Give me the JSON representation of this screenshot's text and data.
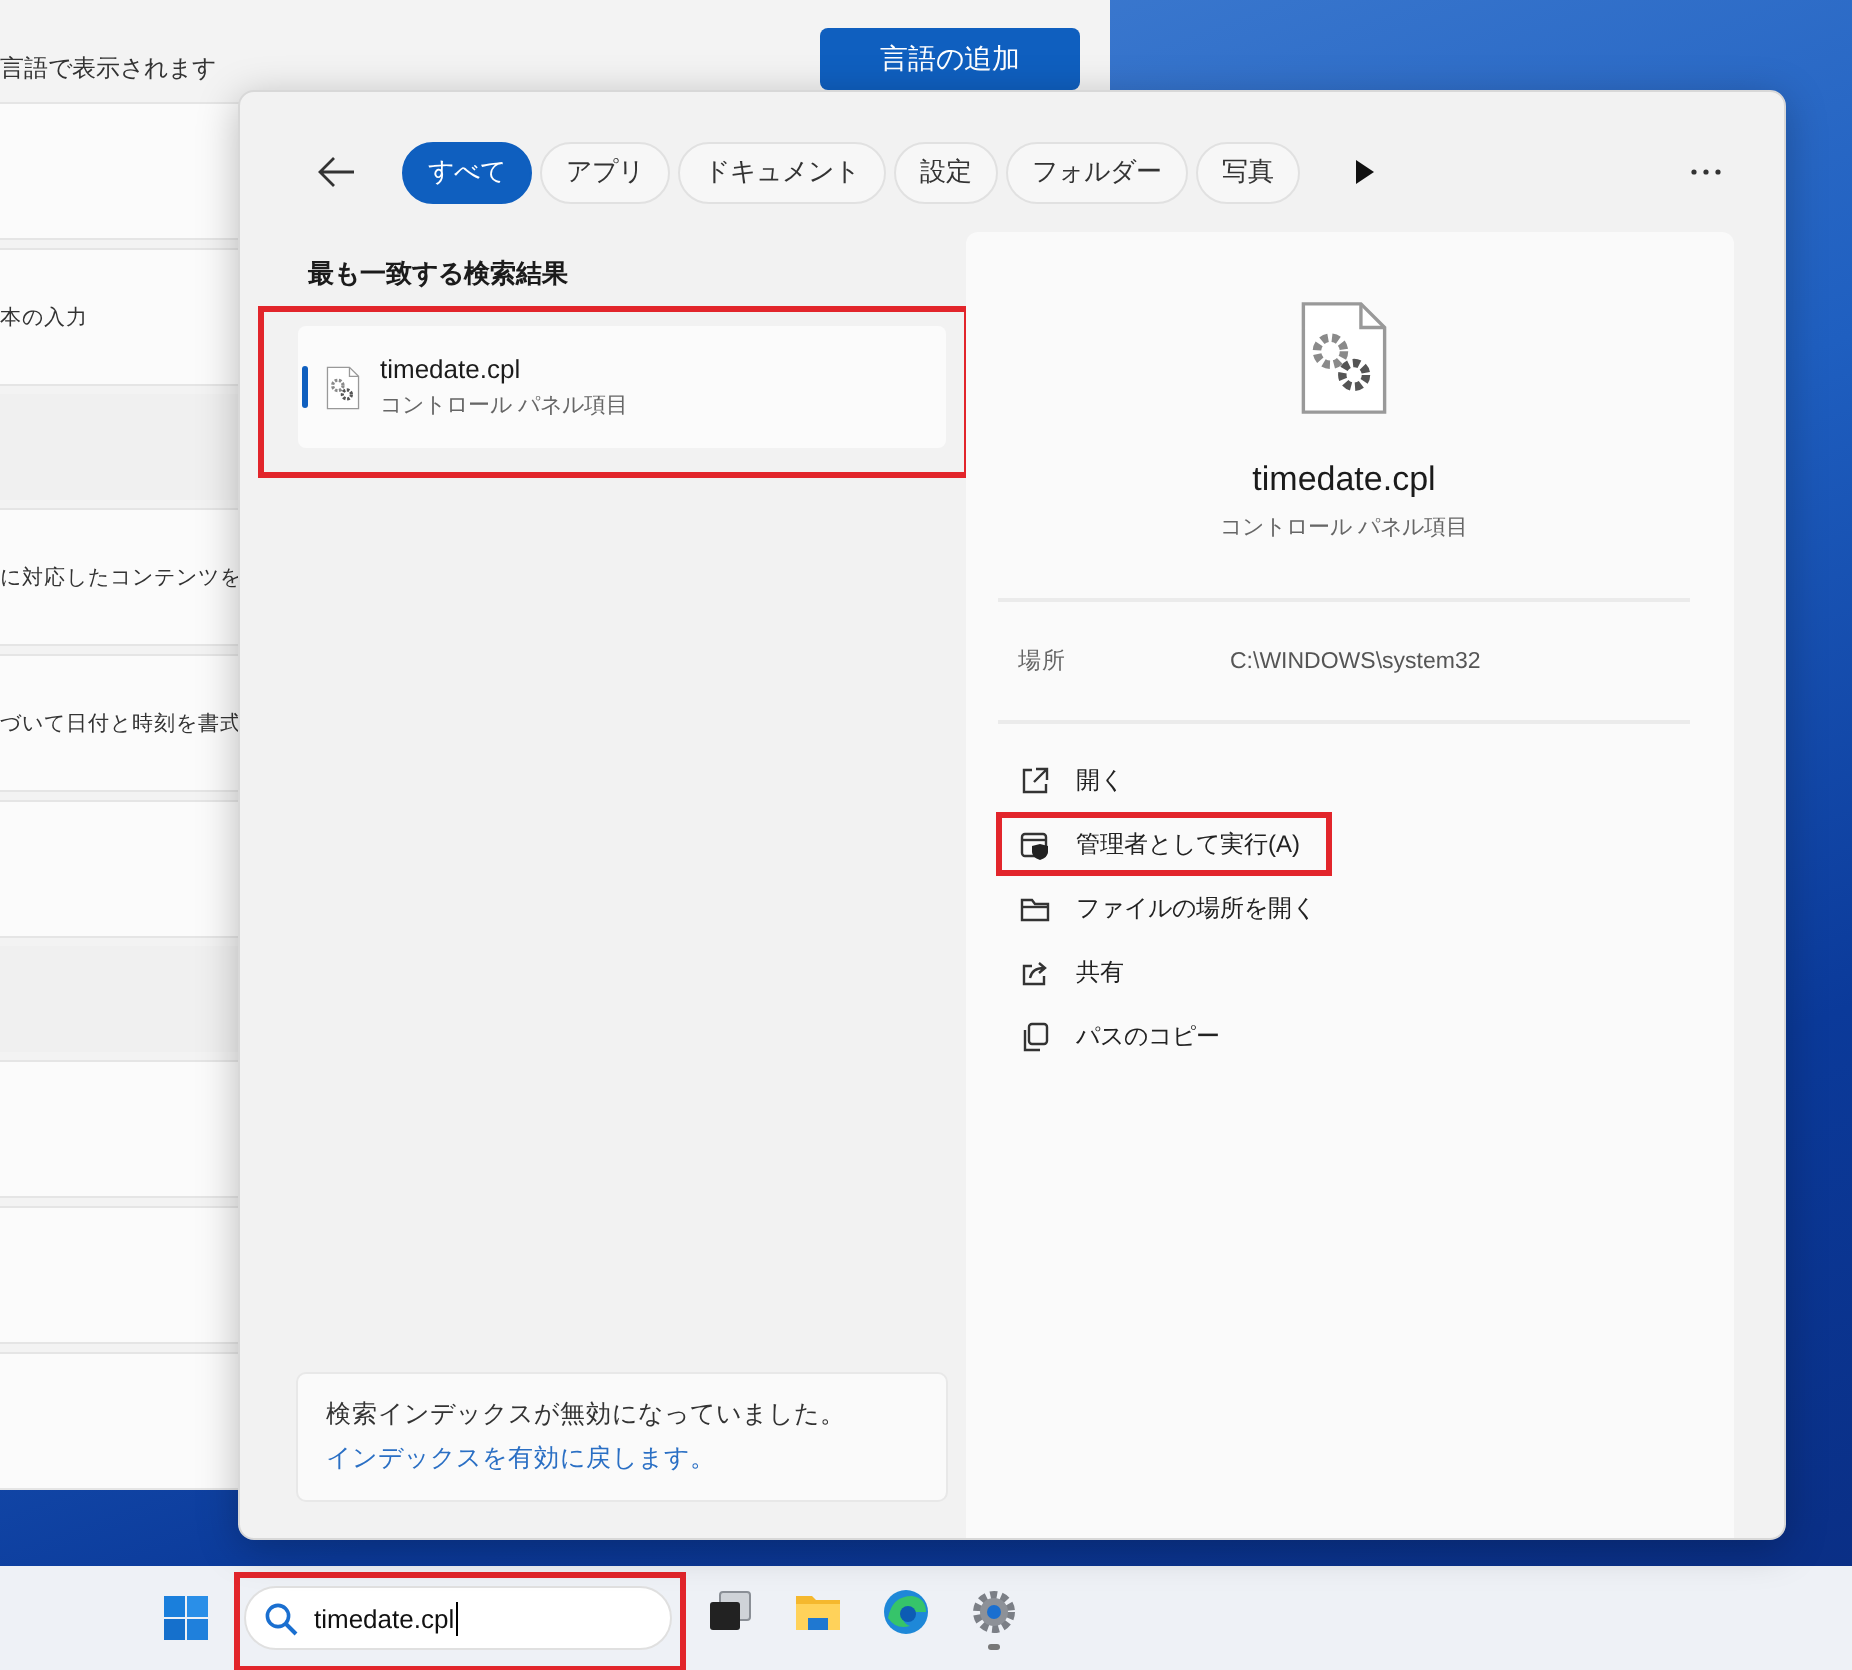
{
  "settings_window": {
    "description": "言語で表示されます",
    "add_button": "言語の追加",
    "rows": [
      {
        "kind": "card"
      },
      {
        "kind": "card",
        "text": "本の入力"
      },
      {
        "kind": "gap"
      },
      {
        "kind": "card",
        "text": "に対応したコンテンツを"
      },
      {
        "kind": "card",
        "text": "づいて日付と時刻を書式"
      },
      {
        "kind": "card"
      },
      {
        "kind": "gap"
      },
      {
        "kind": "card"
      },
      {
        "kind": "card"
      },
      {
        "kind": "card"
      }
    ]
  },
  "search_flyout": {
    "tabs": [
      {
        "label": "すべて",
        "selected": true
      },
      {
        "label": "アプリ",
        "selected": false
      },
      {
        "label": "ドキュメント",
        "selected": false
      },
      {
        "label": "設定",
        "selected": false
      },
      {
        "label": "フォルダー",
        "selected": false
      },
      {
        "label": "写真",
        "selected": false
      }
    ],
    "best_match": {
      "heading": "最も一致する検索結果",
      "results": [
        {
          "title": "timedate.cpl",
          "subtitle": "コントロール パネル項目",
          "selected": true,
          "highlighted": true
        }
      ]
    },
    "notice": {
      "text": "検索インデックスが無効になっていました。",
      "link": "インデックスを有効に戻します。"
    },
    "details": {
      "title": "timedate.cpl",
      "subtitle": "コントロール パネル項目",
      "location_label": "場所",
      "location_value": "C:\\WINDOWS\\system32",
      "actions": [
        {
          "kind": "open",
          "label": "開く",
          "highlighted": false
        },
        {
          "kind": "admin",
          "label": "管理者として実行(A)",
          "highlighted": true
        },
        {
          "kind": "folder",
          "label": "ファイルの場所を開く",
          "highlighted": false
        },
        {
          "kind": "share",
          "label": "共有",
          "highlighted": false
        },
        {
          "kind": "copy",
          "label": "パスのコピー",
          "highlighted": false
        }
      ]
    }
  },
  "taskbar": {
    "search": {
      "value": "timedate.cpl",
      "highlighted": true
    },
    "apps": [
      {
        "kind": "taskview",
        "running": false
      },
      {
        "kind": "explorer",
        "running": false
      },
      {
        "kind": "browser",
        "running": false
      },
      {
        "kind": "settings",
        "running": true
      }
    ]
  }
}
